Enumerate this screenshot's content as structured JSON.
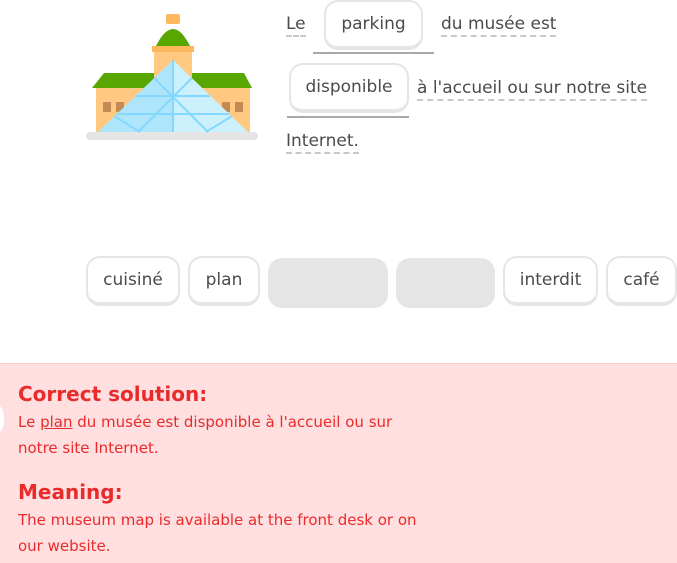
{
  "illustration": {
    "icon": "louvre-museum-icon"
  },
  "sentence": {
    "word_le": "Le",
    "slot1_value": "parking",
    "word_du_musee_est": "du musée est",
    "slot2_value": "disponible",
    "word_accueil": "à l'accueil ou sur notre site",
    "word_internet": "Internet."
  },
  "word_bank": {
    "items": [
      "cuisiné",
      "plan",
      "interdit",
      "café"
    ]
  },
  "feedback": {
    "status": "incorrect",
    "solution_heading": "Correct solution:",
    "solution_prefix": "Le ",
    "solution_highlight": "plan",
    "solution_suffix_line1": " du musée est disponible à l'accueil ou sur",
    "solution_line2": "notre site Internet.",
    "meaning_heading": "Meaning:",
    "meaning_line1": "The museum map is available at the front desk or on",
    "meaning_line2": "our website."
  },
  "colors": {
    "error_text": "#ea2b2b",
    "error_background": "#ffdfe0",
    "chip_border": "#e5e5e5"
  }
}
